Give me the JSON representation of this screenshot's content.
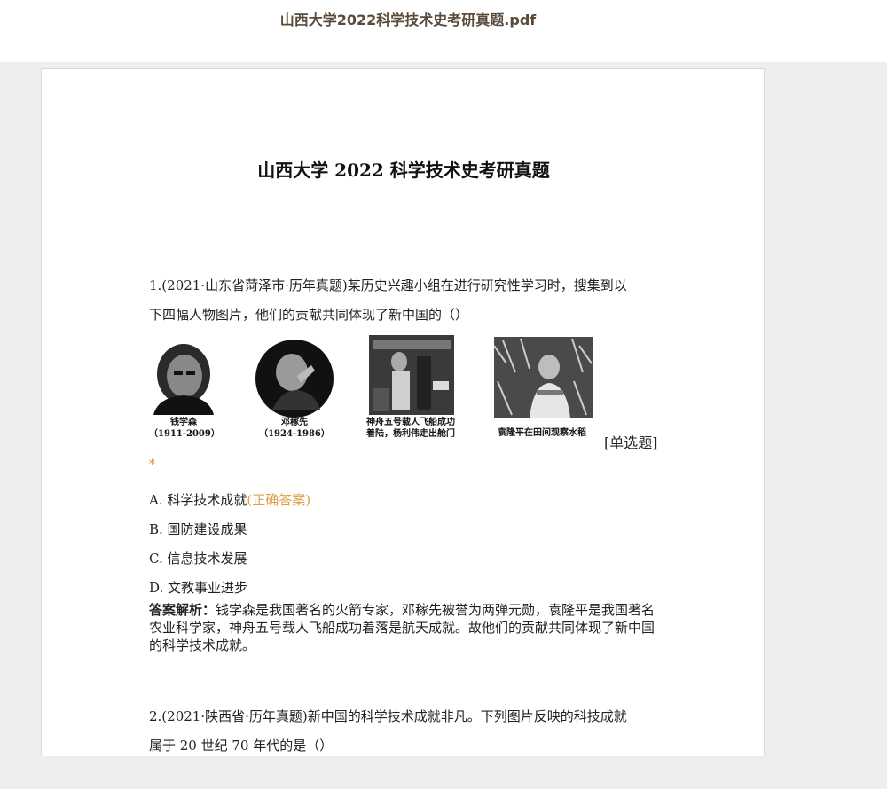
{
  "header": {
    "file_title": "山西大学2022科学技术史考研真题.pdf"
  },
  "document": {
    "title": "山西大学 2022 科学技术史考研真题",
    "question1": {
      "text_line1": "1.(2021·山东省菏泽市·历年真题)某历史兴趣小组在进行研究性学习时，搜集到以",
      "text_line2": "下四幅人物图片，他们的贡献共同体现了新中国的（）",
      "photos": [
        {
          "caption_line1": "钱学森",
          "caption_line2": "（1911-2009）"
        },
        {
          "caption_line1": "邓稼先",
          "caption_line2": "（1924-1986）"
        },
        {
          "caption_line1": "神舟五号载人飞船成功",
          "caption_line2": "着陆，杨利伟走出舱门"
        },
        {
          "caption_line1": "袁隆平在田间观察水稻",
          "caption_line2": ""
        }
      ],
      "type_tag": "[单选题]",
      "required_marker": "*",
      "options": [
        {
          "text": "A. 科学技术成就",
          "note": "(正确答案)"
        },
        {
          "text": "B. 国防建设成果",
          "note": ""
        },
        {
          "text": "C. 信息技术发展",
          "note": ""
        },
        {
          "text": "D. 文教事业进步",
          "note": ""
        }
      ],
      "analysis_label": "答案解析：",
      "analysis_text": "钱学森是我国著名的火箭专家，邓稼先被誉为两弹元勋，袁隆平是我国著名农业科学家，神舟五号载人飞船成功着落是航天成就。故他们的贡献共同体现了新中国的科学技术成就。"
    },
    "question2": {
      "text_line1": "2.(2021·陕西省·历年真题)新中国的科学技术成就非凡。下列图片反映的科技成就",
      "text_line2": "属于 20 世纪 70 年代的是（）"
    }
  }
}
